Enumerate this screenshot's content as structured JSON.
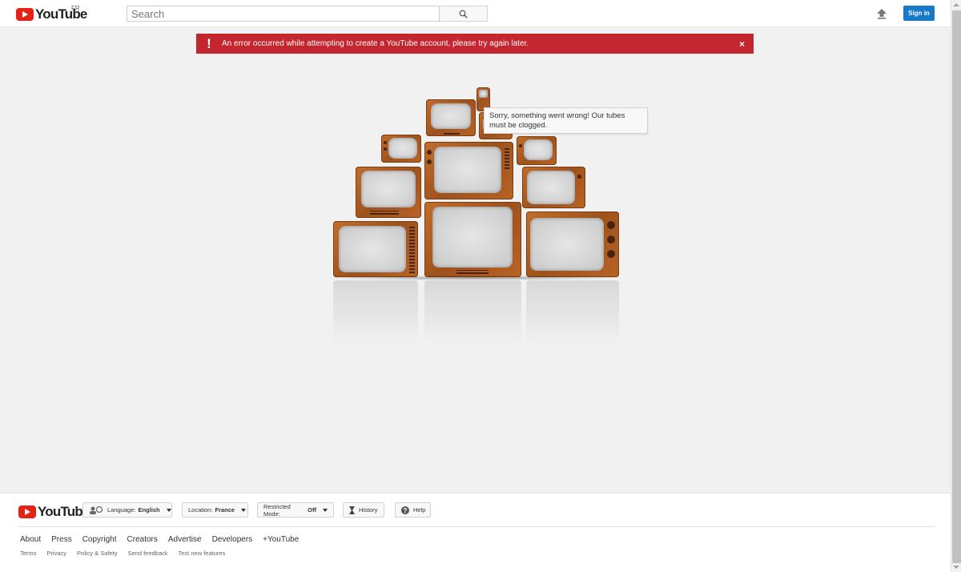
{
  "header": {
    "logo_text": "YouTube",
    "country_code": "FR",
    "search_placeholder": "Search",
    "signin_label": "Sign in"
  },
  "alert": {
    "message": "An error occurred while attempting to create a YouTube account, please try again later.",
    "bang": "!",
    "close": "×",
    "color": "#c4262f"
  },
  "error": {
    "bubble_text": "Sorry, something went wrong! Our tubes must be clogged."
  },
  "footer": {
    "logo_text": "YouTube",
    "language": {
      "label": "Language:",
      "value": "English"
    },
    "location": {
      "label": "Location:",
      "value": "France"
    },
    "restricted": {
      "label": "Restricted Mode:",
      "value": "Off"
    },
    "history_label": "History",
    "help_label": "Help",
    "primary_links": [
      "About",
      "Press",
      "Copyright",
      "Creators",
      "Advertise",
      "Developers",
      "+YouTube"
    ],
    "secondary_links": [
      "Terms",
      "Privacy",
      "Policy & Safety",
      "Send feedback",
      "Test new features"
    ]
  },
  "colors": {
    "brand_red": "#e62117",
    "signin_blue": "#167ac6",
    "page_bg": "#f1f1f1"
  }
}
